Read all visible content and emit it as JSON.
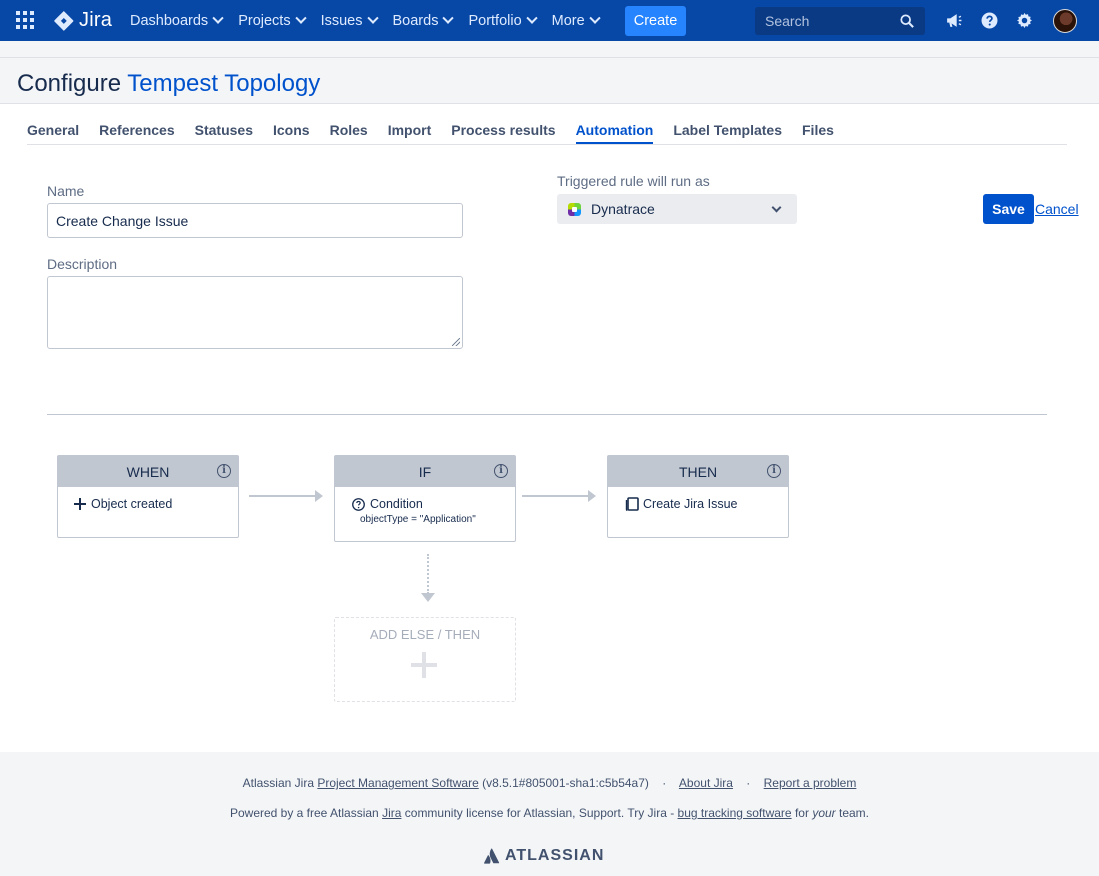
{
  "nav": {
    "product": "Jira",
    "items": [
      {
        "label": "Dashboards"
      },
      {
        "label": "Projects"
      },
      {
        "label": "Issues"
      },
      {
        "label": "Boards"
      },
      {
        "label": "Portfolio"
      },
      {
        "label": "More"
      }
    ],
    "create_label": "Create",
    "search_placeholder": "Search"
  },
  "header": {
    "title_prefix": "Configure",
    "title_object": "Tempest Topology"
  },
  "tabs": [
    {
      "label": "General",
      "active": false
    },
    {
      "label": "References",
      "active": false
    },
    {
      "label": "Statuses",
      "active": false
    },
    {
      "label": "Icons",
      "active": false
    },
    {
      "label": "Roles",
      "active": false
    },
    {
      "label": "Import",
      "active": false
    },
    {
      "label": "Process results",
      "active": false
    },
    {
      "label": "Automation",
      "active": true
    },
    {
      "label": "Label Templates",
      "active": false
    },
    {
      "label": "Files",
      "active": false
    }
  ],
  "form": {
    "name_label": "Name",
    "name_value": "Create Change Issue",
    "description_label": "Description",
    "description_value": "",
    "runas_label": "Triggered rule will run as",
    "runas_value": "Dynatrace",
    "save_label": "Save",
    "cancel_label": "Cancel"
  },
  "rule": {
    "when": {
      "title": "WHEN",
      "item": "Object created"
    },
    "if": {
      "title": "IF",
      "item": "Condition",
      "detail": "objectType = \"Application\""
    },
    "then": {
      "title": "THEN",
      "item": "Create Jira Issue"
    },
    "add_label": "ADD ELSE / THEN"
  },
  "footer": {
    "line1_prefix": "Atlassian Jira",
    "line1_link": "Project Management Software",
    "line1_version": "(v8.5.1#805001-sha1:c5b54a7)",
    "about": "About Jira",
    "report": "Report a problem",
    "line2_prefix": "Powered by a free Atlassian",
    "line2_jira": "Jira",
    "line2_mid": "community license for Atlassian, Support. Try Jira -",
    "line2_link": "bug tracking software",
    "line2_for": "for",
    "line2_your": "your",
    "line2_end": "team.",
    "brand": "ATLASSIAN"
  },
  "colors": {
    "nav_bg": "#0747a6",
    "accent": "#0052cc",
    "create_bg": "#2684ff"
  }
}
